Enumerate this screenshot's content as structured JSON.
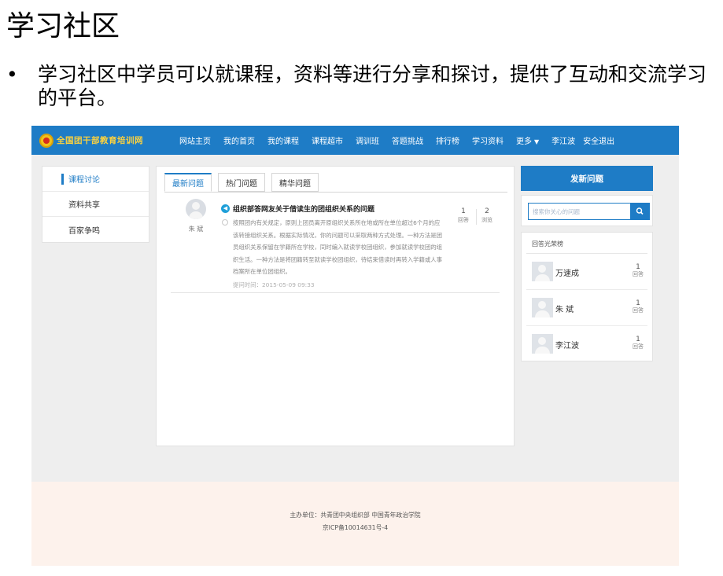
{
  "slide": {
    "title": "学习社区",
    "bullet_marker": "•",
    "bullet": "学习社区中学员可以就课程，资料等进行分享和探讨，提供了互动和交流学习的平台。"
  },
  "header": {
    "logo_text": "全国团干部教育培训网",
    "nav": [
      "网站主页",
      "我的首页",
      "我的课程",
      "课程超市",
      "调训班",
      "答题挑战",
      "排行榜",
      "学习资料"
    ],
    "more_label": "更多",
    "user_name": "李江波",
    "logout_label": "安全退出"
  },
  "sidebar": {
    "items": [
      {
        "label": "课程讨论",
        "active": true
      },
      {
        "label": "资料共享",
        "active": false
      },
      {
        "label": "百家争鸣",
        "active": false
      }
    ]
  },
  "main": {
    "tabs": [
      "最新问题",
      "热门问题",
      "精华问题"
    ],
    "active_tab": "最新问题",
    "question": {
      "author": "朱 斌",
      "title": "组织部答网友关于借读生的团组织关系的问题",
      "body": "按照团内有关规定，原则上团员离开原组织关系所在地或所在单位超过6个月的应该转接组织关系。根据实际情况，你的问题可以采取两种方式处理。一种方法是团员组织关系保留在学籍所在学校，同时编入就读学校团组织，参加就读学校团的组织生活。一种方法是将团籍转至就读学校团组织，待结束借读时再转入学籍或人事档案所在单位团组织。",
      "time_label": "提问时间：",
      "time": "2015-05-09 09:33",
      "answers": "1",
      "answers_label": "回答",
      "views": "2",
      "views_label": "浏览"
    }
  },
  "right": {
    "ask_button": "发新问题",
    "search_placeholder": "搜索你关心的问题",
    "honor_title": "回答光荣榜",
    "honor_list": [
      {
        "name": "万速成",
        "count": "1",
        "label": "回答"
      },
      {
        "name": "朱 斌",
        "count": "1",
        "label": "回答"
      },
      {
        "name": "李江波",
        "count": "1",
        "label": "回答"
      }
    ]
  },
  "footer": {
    "line1": "主办单位：共青团中央组织部 中国青年政治学院",
    "line2": "京ICP备10014631号-4"
  },
  "colors": {
    "accent": "#1e7cc6",
    "logo_text": "#ffd33d",
    "footer_bg": "#fdf2ec",
    "page_bg": "#eeeeee"
  },
  "icons": [
    "party-emblem-icon",
    "chevron-down-icon",
    "speaker-icon",
    "radio-icon",
    "search-icon",
    "avatar-icon"
  ]
}
